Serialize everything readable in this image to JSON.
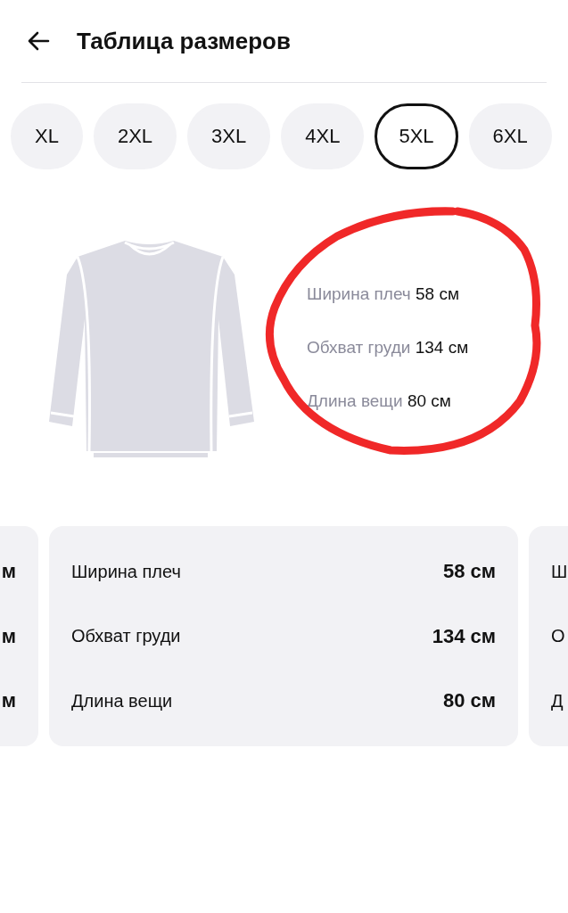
{
  "header": {
    "title": "Таблица размеров"
  },
  "sizes": [
    {
      "label": "XL",
      "selected": false
    },
    {
      "label": "2XL",
      "selected": false
    },
    {
      "label": "3XL",
      "selected": false
    },
    {
      "label": "4XL",
      "selected": false
    },
    {
      "label": "5XL",
      "selected": true
    },
    {
      "label": "6XL",
      "selected": false
    }
  ],
  "summary": [
    {
      "label": "Ширина плеч",
      "value": "58 см"
    },
    {
      "label": "Обхват груди",
      "value": "134 см"
    },
    {
      "label": "Длина вещи",
      "value": "80 см"
    }
  ],
  "cards": [
    {
      "rows": [
        {
          "value": "м"
        },
        {
          "value": "м"
        },
        {
          "value": "м"
        }
      ]
    },
    {
      "rows": [
        {
          "label": "Ширина плеч",
          "value": "58 см"
        },
        {
          "label": "Обхват груди",
          "value": "134 см"
        },
        {
          "label": "Длина вещи",
          "value": "80 см"
        }
      ]
    },
    {
      "rows": [
        {
          "label": "Ш"
        },
        {
          "label": "О"
        },
        {
          "label": "Д"
        }
      ]
    }
  ]
}
